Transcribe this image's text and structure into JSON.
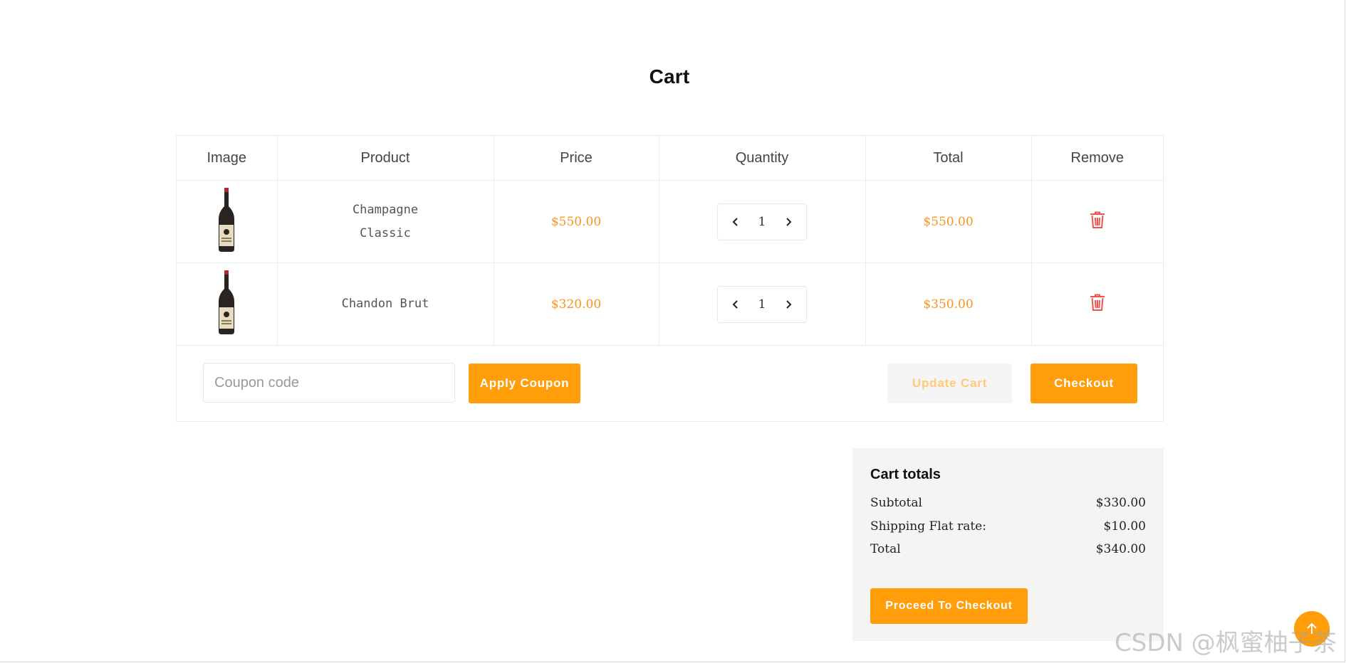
{
  "page": {
    "title": "Cart"
  },
  "table": {
    "headers": [
      "Image",
      "Product",
      "Price",
      "Quantity",
      "Total",
      "Remove"
    ],
    "rows": [
      {
        "product": "Champagne Classic",
        "product_line1": "Champagne",
        "product_line2": "Classic",
        "price": "$550.00",
        "quantity": "1",
        "total": "$550.00",
        "image_icon": "wine-bottle-icon"
      },
      {
        "product": "Chandon Brut",
        "price": "$320.00",
        "quantity": "1",
        "total": "$350.00",
        "image_icon": "wine-bottle-icon"
      }
    ]
  },
  "coupon": {
    "placeholder": "Coupon code",
    "apply_label": "Apply Coupon"
  },
  "actions": {
    "update_label": "Update Cart",
    "checkout_label": "Checkout"
  },
  "totals": {
    "title": "Cart totals",
    "subtotal_label": "Subtotal",
    "subtotal_value": "$330.00",
    "shipping_label": "Shipping Flat rate:",
    "shipping_value": "$10.00",
    "total_label": "Total",
    "total_value": "$340.00",
    "proceed_label": "Proceed To Checkout"
  },
  "watermark": "CSDN @枫蜜柚子茶",
  "colors": {
    "accent": "#ff9d0b",
    "price": "#f7941d",
    "remove": "#f0524f",
    "totals_bg": "#f4f4f2"
  }
}
